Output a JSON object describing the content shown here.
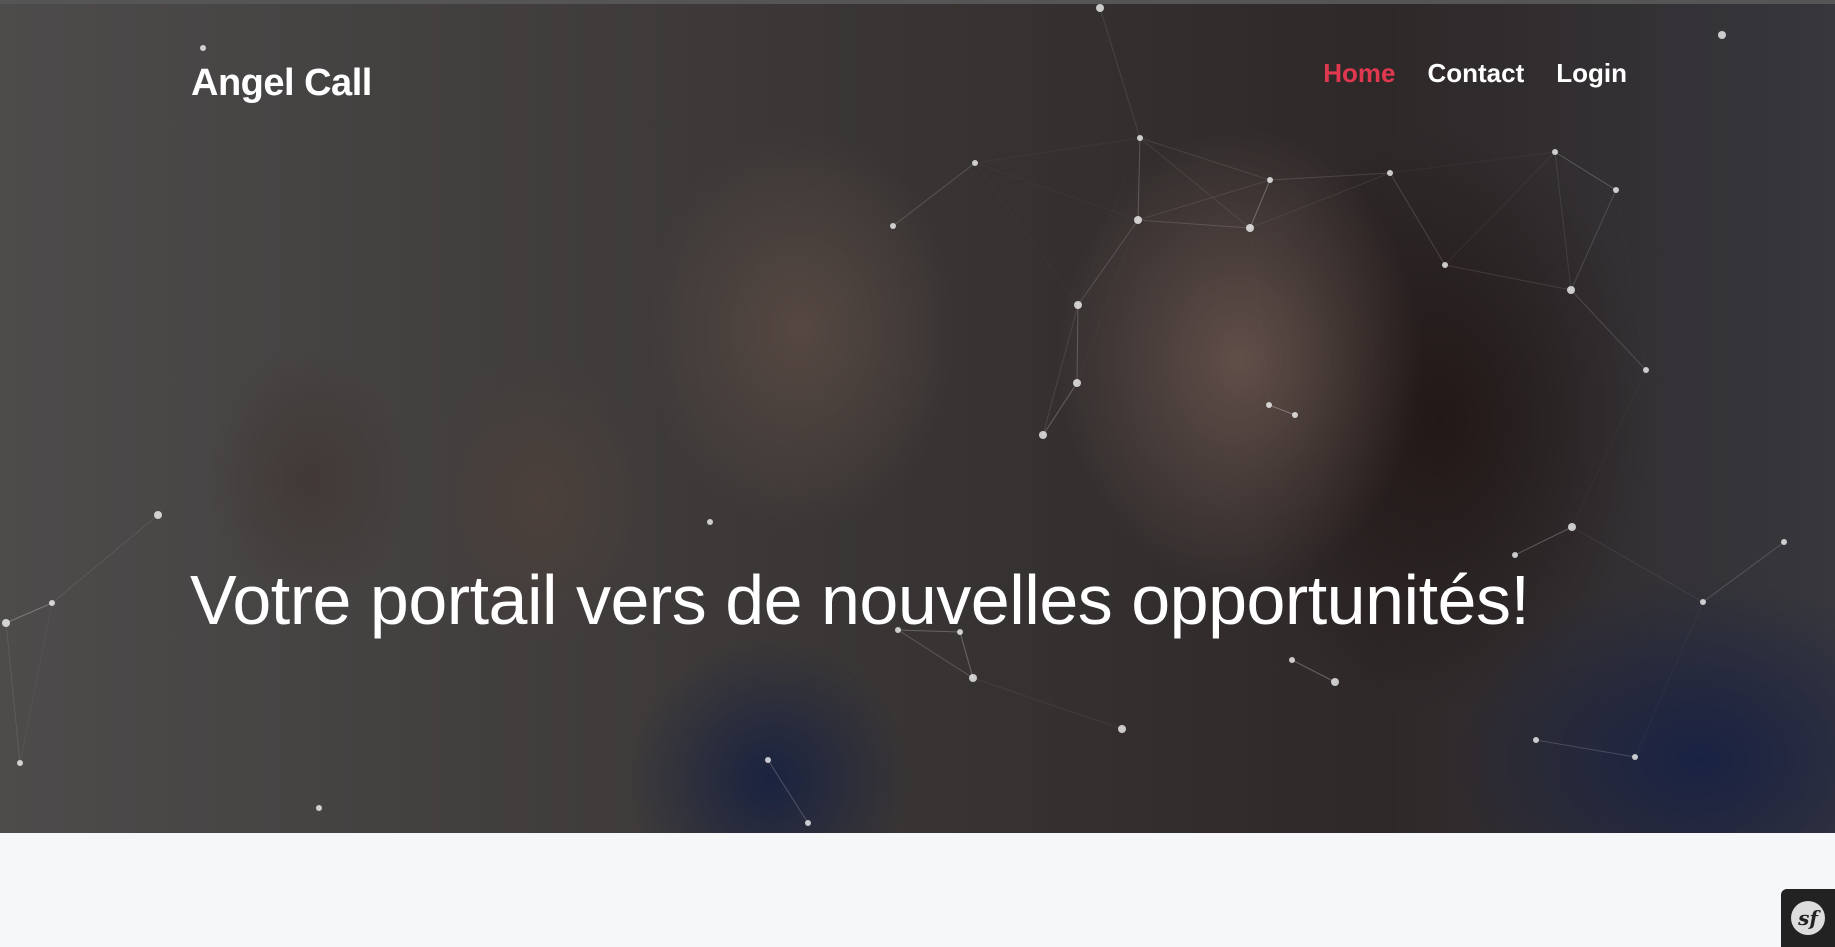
{
  "brand": {
    "name": "Angel Call"
  },
  "nav": {
    "items": [
      {
        "label": "Home",
        "active": true
      },
      {
        "label": "Contact",
        "active": false
      },
      {
        "label": "Login",
        "active": false
      }
    ]
  },
  "hero": {
    "headline": "Votre portail vers de nouvelles opportunités!"
  },
  "colors": {
    "accent": "#e0384f",
    "text": "#ffffff",
    "page_background": "#f6f7f9"
  },
  "debug_toolbar": {
    "icon": "symfony-logo-icon",
    "glyph": "sf"
  }
}
